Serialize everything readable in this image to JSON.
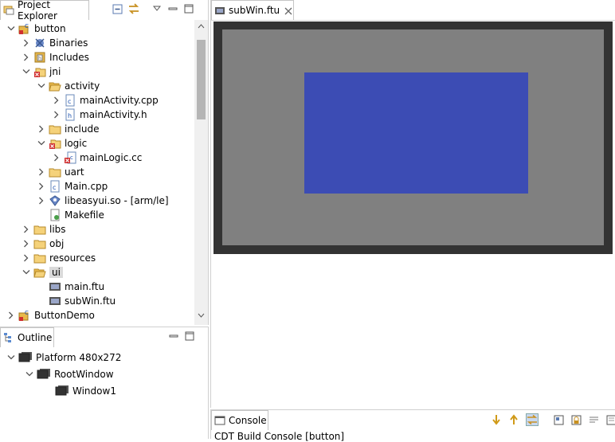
{
  "project_explorer": {
    "tab_label": "Project Explorer",
    "items": [
      {
        "label": "button",
        "depth": 0,
        "arrow": "down",
        "icon": "c-project-icon"
      },
      {
        "label": "Binaries",
        "depth": 1,
        "arrow": "right",
        "icon": "binaries-icon"
      },
      {
        "label": "Includes",
        "depth": 1,
        "arrow": "right",
        "icon": "includes-icon"
      },
      {
        "label": "jni",
        "depth": 1,
        "arrow": "down",
        "icon": "folder-error-icon"
      },
      {
        "label": "activity",
        "depth": 2,
        "arrow": "down",
        "icon": "folder-open-icon"
      },
      {
        "label": "mainActivity.cpp",
        "depth": 3,
        "arrow": "right",
        "icon": "cpp-file-icon"
      },
      {
        "label": "mainActivity.h",
        "depth": 3,
        "arrow": "right",
        "icon": "header-file-icon"
      },
      {
        "label": "include",
        "depth": 2,
        "arrow": "right",
        "icon": "folder-icon"
      },
      {
        "label": "logic",
        "depth": 2,
        "arrow": "down",
        "icon": "folder-error-icon"
      },
      {
        "label": "mainLogic.cc",
        "depth": 3,
        "arrow": "right",
        "icon": "cc-file-error-icon"
      },
      {
        "label": "uart",
        "depth": 2,
        "arrow": "right",
        "icon": "folder-icon"
      },
      {
        "label": "Main.cpp",
        "depth": 2,
        "arrow": "right",
        "icon": "cpp-file-icon"
      },
      {
        "label": "libeasyui.so - [arm/le]",
        "depth": 2,
        "arrow": "right",
        "icon": "shared-lib-icon"
      },
      {
        "label": "Makefile",
        "depth": 2,
        "arrow": "none",
        "icon": "makefile-icon"
      },
      {
        "label": "libs",
        "depth": 1,
        "arrow": "right",
        "icon": "folder-icon"
      },
      {
        "label": "obj",
        "depth": 1,
        "arrow": "right",
        "icon": "folder-icon"
      },
      {
        "label": "resources",
        "depth": 1,
        "arrow": "right",
        "icon": "folder-icon"
      },
      {
        "label": "ui",
        "depth": 1,
        "arrow": "down",
        "icon": "folder-open-icon",
        "selected": true
      },
      {
        "label": "main.ftu",
        "depth": 2,
        "arrow": "none",
        "icon": "ftu-file-icon"
      },
      {
        "label": "subWin.ftu",
        "depth": 2,
        "arrow": "none",
        "icon": "ftu-file-icon"
      },
      {
        "label": "ButtonDemo",
        "depth": 0,
        "arrow": "right",
        "icon": "c-project-icon"
      }
    ]
  },
  "outline": {
    "tab_label": "Outline",
    "items": [
      {
        "label": "Platform 480x272",
        "depth": 0
      },
      {
        "label": "RootWindow",
        "depth": 1
      },
      {
        "label": "Window1",
        "depth": 2
      }
    ]
  },
  "editor": {
    "tab_label": "subWin.ftu",
    "colors": {
      "frame": "#333333",
      "canvas": "#808080",
      "window": "#3c4cb4"
    }
  },
  "console": {
    "tab_label": "Console",
    "text": "CDT Build Console [button]"
  },
  "colors": {
    "selection": "#dadada",
    "folder": "#e8b84a",
    "accent": "#3c4cb4"
  }
}
